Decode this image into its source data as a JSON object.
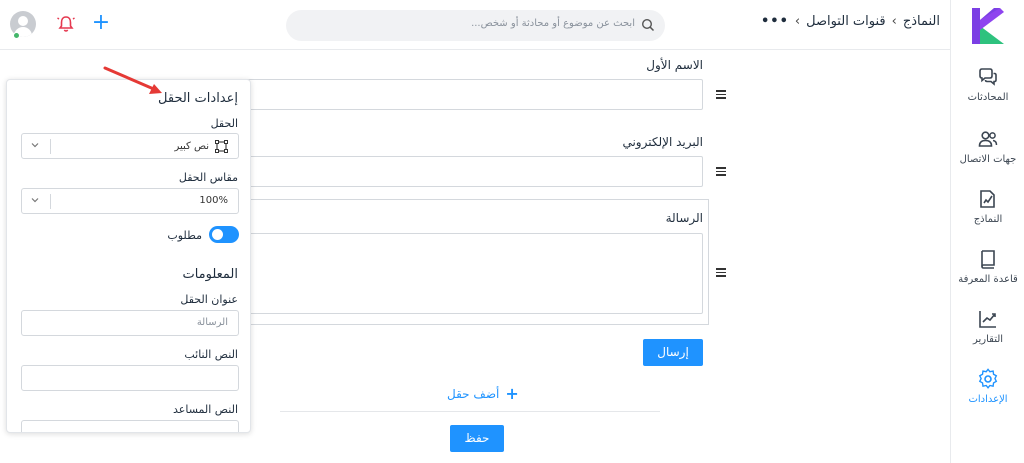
{
  "topbar": {
    "search_placeholder": "ابحث عن موضوع أو محادثة أو شخص...",
    "breadcrumb": [
      "قنوات التواصل",
      "النماذج"
    ]
  },
  "nav": {
    "items": [
      {
        "label": "المحادثات",
        "icon": "chat-icon"
      },
      {
        "label": "جهات الاتصال",
        "icon": "contacts-icon"
      },
      {
        "label": "النماذج",
        "icon": "forms-icon"
      },
      {
        "label": "قاعدة المعرفة",
        "icon": "book-icon"
      },
      {
        "label": "التقارير",
        "icon": "chart-icon"
      },
      {
        "label": "الإعدادات",
        "icon": "gear-icon",
        "active": true
      }
    ]
  },
  "form": {
    "fields": [
      {
        "label": "الاسم الأول"
      },
      {
        "label": "البريد الإلكتروني"
      },
      {
        "label": "الرسالة"
      }
    ],
    "submit_label": "إرسال",
    "add_field_label": "أضف حقل",
    "save_label": "حفظ"
  },
  "settings_panel": {
    "title": "إعدادات الحقل",
    "field_label": "الحقل",
    "field_value": "نص كبير",
    "size_label": "مقاس الحقل",
    "size_value": "100%",
    "required_label": "مطلوب",
    "required_on": true,
    "info_title": "المعلومات",
    "field_title_label": "عنوان الحقل",
    "field_title_value": "الرسالة",
    "placeholder_label": "النص النائب",
    "helper_label": "النص المساعد"
  },
  "colors": {
    "accent": "#1f93ff",
    "arrow": "#e53935"
  }
}
